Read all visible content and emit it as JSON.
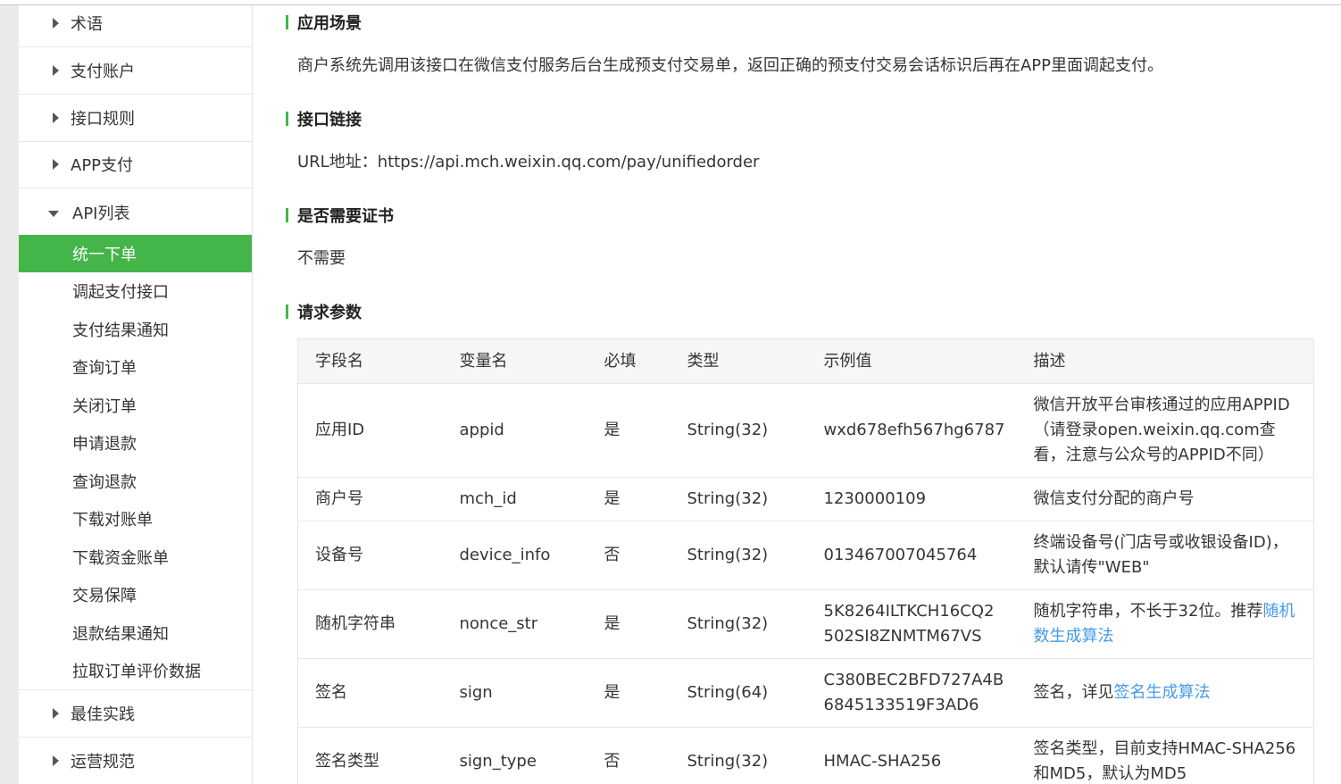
{
  "sidebar": {
    "groups": [
      {
        "label": "术语"
      },
      {
        "label": "支付账户"
      },
      {
        "label": "接口规则"
      },
      {
        "label": "APP支付"
      },
      {
        "label": "API列表"
      },
      {
        "label": "最佳实践"
      },
      {
        "label": "运营规范"
      }
    ],
    "api_items": [
      {
        "label": "统一下单"
      },
      {
        "label": "调起支付接口"
      },
      {
        "label": "支付结果通知"
      },
      {
        "label": "查询订单"
      },
      {
        "label": "关闭订单"
      },
      {
        "label": "申请退款"
      },
      {
        "label": "查询退款"
      },
      {
        "label": "下载对账单"
      },
      {
        "label": "下载资金账单"
      },
      {
        "label": "交易保障"
      },
      {
        "label": "退款结果通知"
      },
      {
        "label": "拉取订单评价数据"
      }
    ],
    "active_item": "统一下单"
  },
  "main": {
    "scene": {
      "title": "应用场景",
      "text": "商户系统先调用该接口在微信支付服务后台生成预支付交易单，返回正确的预支付交易会话标识后再在APP里面调起支付。"
    },
    "link": {
      "title": "接口链接",
      "text": "URL地址：https://api.mch.weixin.qq.com/pay/unifiedorder"
    },
    "cert": {
      "title": "是否需要证书",
      "text": "不需要"
    },
    "params": {
      "title": "请求参数",
      "headers": {
        "field": "字段名",
        "var": "变量名",
        "required": "必填",
        "type": "类型",
        "example": "示例值",
        "desc": "描述"
      },
      "rows": [
        {
          "field": "应用ID",
          "var": "appid",
          "required": "是",
          "type": "String(32)",
          "example": "wxd678efh567hg6787",
          "desc": "微信开放平台审核通过的应用APPID（请登录open.weixin.qq.com查看，注意与公众号的APPID不同）",
          "desc_link": ""
        },
        {
          "field": "商户号",
          "var": "mch_id",
          "required": "是",
          "type": "String(32)",
          "example": "1230000109",
          "desc": "微信支付分配的商户号",
          "desc_link": ""
        },
        {
          "field": "设备号",
          "var": "device_info",
          "required": "否",
          "type": "String(32)",
          "example": "013467007045764",
          "desc": "终端设备号(门店号或收银设备ID)，默认请传\"WEB\"",
          "desc_link": ""
        },
        {
          "field": "随机字符串",
          "var": "nonce_str",
          "required": "是",
          "type": "String(32)",
          "example": "5K8264ILTKCH16CQ2502SI8ZNMTM67VS",
          "desc": "随机字符串，不长于32位。推荐",
          "desc_link": "随机数生成算法"
        },
        {
          "field": "签名",
          "var": "sign",
          "required": "是",
          "type": "String(64)",
          "example": "C380BEC2BFD727A4B6845133519F3AD6",
          "desc": "签名，详见",
          "desc_link": "签名生成算法"
        },
        {
          "field": "签名类型",
          "var": "sign_type",
          "required": "否",
          "type": "String(32)",
          "example": "HMAC-SHA256",
          "desc": "签名类型，目前支持HMAC-SHA256和MD5，默认为MD5",
          "desc_link": ""
        }
      ]
    }
  }
}
